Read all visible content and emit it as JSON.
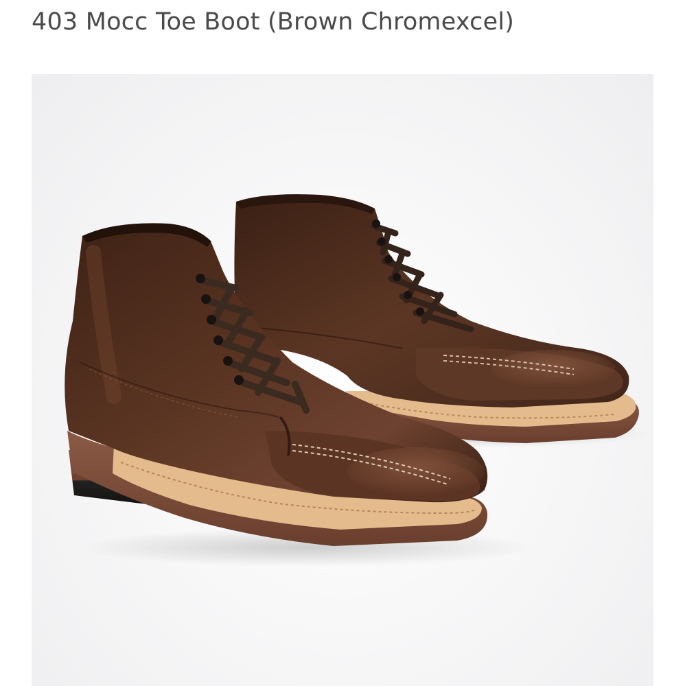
{
  "product": {
    "title": "403 Mocc Toe Boot (Brown Chromexcel)",
    "image_subject": "boots-photo"
  },
  "colors": {
    "title_text": "#4a4a4a",
    "leather": "#4a2a1c",
    "leather_highlight": "#7a4a32",
    "welt": "#e2b888",
    "sole": "#7a4a36",
    "heel_base": "#1e1a18",
    "laces": "#3a2a20"
  }
}
